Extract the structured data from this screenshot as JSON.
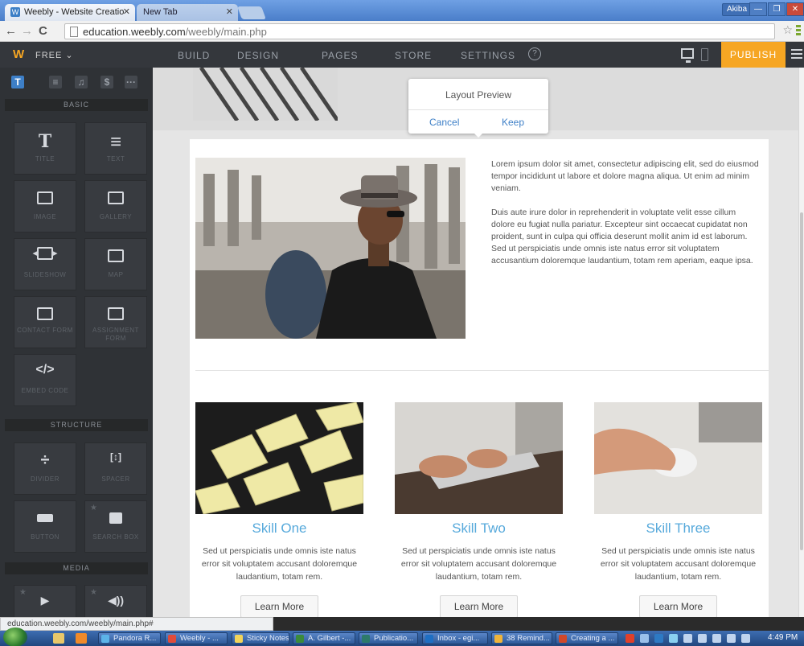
{
  "browser": {
    "tabs": [
      {
        "title": "Weebly - Website Creatio",
        "active": true
      },
      {
        "title": "New Tab",
        "active": false
      }
    ],
    "user_badge": "Akiba",
    "url_host": "education.weebly.com",
    "url_path": "/weebly/main.php",
    "status_url": "education.weebly.com/weebly/main.php#"
  },
  "weebly_toolbar": {
    "logo": "W",
    "plan": "FREE",
    "nav": [
      "BUILD",
      "DESIGN",
      "PAGES",
      "STORE",
      "SETTINGS"
    ],
    "help": "?",
    "publish": "PUBLISH"
  },
  "sidebar": {
    "category_icons": [
      "T",
      "≡",
      "♫",
      "$",
      "···"
    ],
    "sections": {
      "basic": "BASIC",
      "structure": "STRUCTURE",
      "media": "MEDIA"
    },
    "basic_items": [
      {
        "glyph": "T",
        "label": "TITLE"
      },
      {
        "glyph": "≡",
        "label": "TEXT"
      },
      {
        "glyph": "",
        "label": "IMAGE"
      },
      {
        "glyph": "",
        "label": "GALLERY"
      },
      {
        "glyph": "",
        "label": "SLIDESHOW"
      },
      {
        "glyph": "",
        "label": "MAP"
      },
      {
        "glyph": "",
        "label": "CONTACT FORM"
      },
      {
        "glyph": "",
        "label": "ASSIGNMENT FORM"
      },
      {
        "glyph": "</>",
        "label": "EMBED CODE"
      }
    ],
    "structure_items": [
      {
        "glyph": "÷",
        "label": "DIVIDER"
      },
      {
        "glyph": "[↕]",
        "label": "SPACER"
      },
      {
        "glyph": "",
        "label": "BUTTON"
      },
      {
        "glyph": "",
        "label": "SEARCH BOX"
      }
    ],
    "media_items": [
      {
        "glyph": "▶",
        "label": ""
      },
      {
        "glyph": "◀))",
        "label": ""
      }
    ]
  },
  "popup": {
    "title": "Layout Preview",
    "cancel": "Cancel",
    "keep": "Keep"
  },
  "content": {
    "intro_paragraphs": [
      "Lorem ipsum dolor sit amet, consectetur adipiscing elit, sed do eiusmod tempor incididunt ut labore et dolore magna aliqua. Ut enim ad minim veniam.",
      "Duis aute irure dolor in reprehenderit in voluptate velit esse cillum dolore eu fugiat nulla pariatur. Excepteur sint occaecat cupidatat non proident, sunt in culpa qui officia deserunt mollit anim id est laborum. Sed ut perspiciatis unde omnis iste natus error sit voluptatem accusantium doloremque laudantium, totam rem aperiam, eaque ipsa."
    ],
    "skills": [
      {
        "title": "Skill One",
        "desc": "Sed ut perspiciatis unde omnis iste natus error sit voluptatem accusant doloremque laudantium, totam rem.",
        "button": "Learn More"
      },
      {
        "title": "Skill Two",
        "desc": "Sed ut perspiciatis unde omnis iste natus error sit voluptatem accusant doloremque laudantium, totam rem.",
        "button": "Learn More"
      },
      {
        "title": "Skill Three",
        "desc": "Sed ut perspiciatis unde omnis iste natus error sit voluptatem accusant doloremque laudantium, totam rem.",
        "button": "Learn More"
      }
    ]
  },
  "taskbar": {
    "items": [
      "Pandora R...",
      "Weebly - ...",
      "Sticky Notes",
      "A. Gilbert -...",
      "Publicatio...",
      "Inbox - egi...",
      "38 Remind...",
      "Creating a ..."
    ],
    "clock": "4:49 PM"
  },
  "colors": {
    "weebly_accent": "#f6a623",
    "link_blue": "#3d7fc7",
    "skill_title": "#56a9db"
  }
}
